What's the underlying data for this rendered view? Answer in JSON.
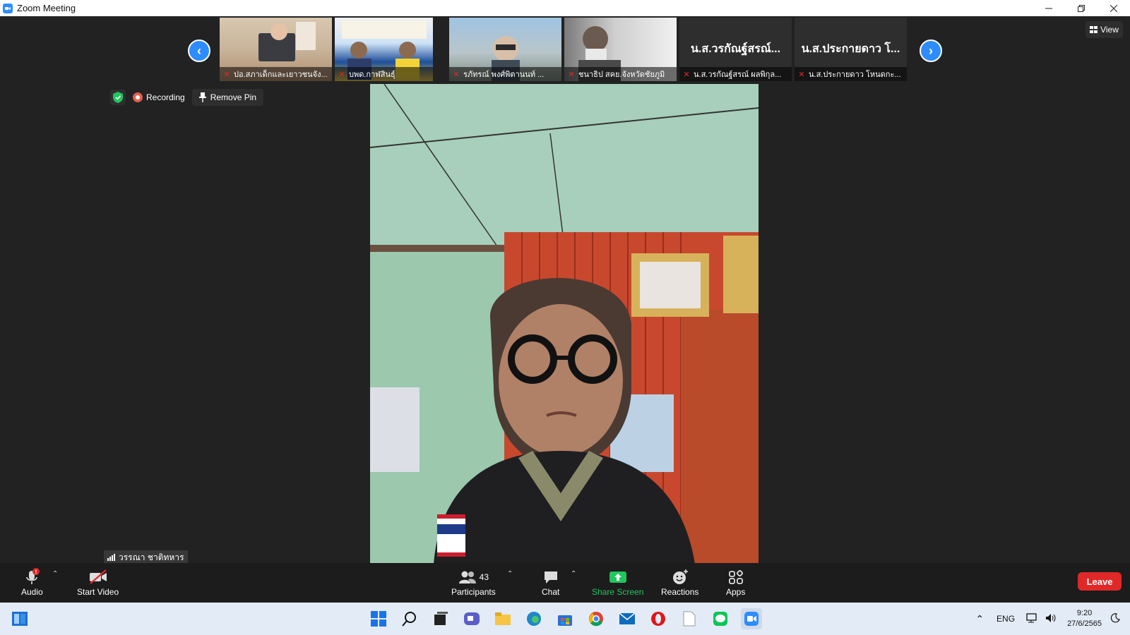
{
  "window": {
    "title": "Zoom Meeting",
    "controls": [
      "minimize",
      "restore",
      "close"
    ]
  },
  "gallery": {
    "tiles": [
      {
        "name": "ปอ.สภาเด็กและเยาวชนจัง...",
        "muted": true,
        "has_video": true
      },
      {
        "name": "บพด.กาฬสินธุ์",
        "muted": true,
        "has_video": true
      },
      {
        "name": "รภัทรณ์ พงศ์พิตานนท์ ...",
        "muted": true,
        "has_video": true
      },
      {
        "name": "ชนาธิป สคย.จังหวัดชัยภูมิ",
        "muted": true,
        "has_video": true
      },
      {
        "name": "น.ส.วรกัณฐ์สรณ์ ผลพิกุล...",
        "muted": true,
        "has_video": false,
        "display_name": "น.ส.วรกัณฐ์สรณ์..."
      },
      {
        "name": "น.ส.ประกายดาว โหนดกะ...",
        "muted": true,
        "has_video": false,
        "display_name": "น.ส.ประกายดาว โ..."
      }
    ],
    "view_label": "View"
  },
  "status": {
    "recording_label": "Recording",
    "remove_pin_label": "Remove Pin"
  },
  "self_view": {
    "name": "วรรณา ชาติทหาร"
  },
  "toolbar": {
    "audio_label": "Audio",
    "start_video_label": "Start Video",
    "participants_label": "Participants",
    "participants_count": "43",
    "chat_label": "Chat",
    "share_screen_label": "Share Screen",
    "reactions_label": "Reactions",
    "apps_label": "Apps",
    "leave_label": "Leave",
    "share_color": "#22c55e"
  },
  "taskbar": {
    "language": "ENG",
    "time": "9:20",
    "date": "27/6/2565"
  }
}
